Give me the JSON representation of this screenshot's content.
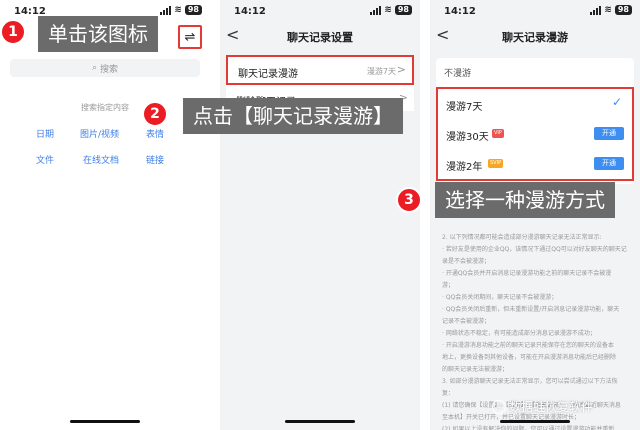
{
  "status_bar": {
    "time": "14:12",
    "battery": "98",
    "wifi": "≋"
  },
  "phone1": {
    "search_placeholder": "搜索",
    "search_icon": "⌕",
    "filter_icon": "⇌",
    "hint": "搜索指定内容",
    "categories": [
      "日期",
      "图片/视频",
      "表情",
      "文件",
      "在线文档",
      "链接"
    ]
  },
  "phone2": {
    "back": "<",
    "title": "聊天记录设置",
    "roam_label": "聊天记录漫游",
    "roam_value": "漫游7天",
    "roam_chevron": ">",
    "delete_label": "删除聊天记录",
    "delete_chevron": ">"
  },
  "phone3": {
    "back": "<",
    "title": "聊天记录漫游",
    "section": "不漫游",
    "plans": [
      {
        "name": "漫游7天",
        "check": "✓"
      },
      {
        "name": "漫游30天",
        "badge": "VIP",
        "button": "开通"
      },
      {
        "name": "漫游2年",
        "badge": "SVIP",
        "button": "开通"
      }
    ],
    "notes": [
      "2. 以下列情况都可能会造成部分漫游聊天记录无法正常显示:",
      "· 若好友是使用的企业QQ，该情况下通过QQ可以对好友聊天的聊天记",
      "录是不会被漫游；",
      "· 开通QQ会员并开启消息记录漫游功能之前的聊天记录不会被漫",
      "游；",
      "· QQ会员关闭期间，聊天记录不会被漫游；",
      "· QQ会员关闭后重新，但未重新设置/开启消息记录漫游功能，聊天",
      "记录不会被漫游；",
      "· 网络状态不稳定，有可能造成部分消息记录漫游不成功；",
      "· 开启漫游消息功能之前的聊天记录只能保存在您的聊天的设备本",
      "地上，更换设备到其他设备，可能在开启漫游消息功能后已经删除",
      "的聊天记录无法被漫游；",
      "3. 如部分漫游聊天记录无法正常显示，您可以尝试通过以下方法恢",
      "复：",
      "(1) 请您确保【设置】-【通用】-【聊天记录】-【同步最近聊天消息",
      "至本机】开关已打开，并已设置聊天记录漫游时长；",
      "(2) 如果以上没有解决你的问题，您可以通过设置漫游功能并重新",
      "备聊期的同步设备。"
    ]
  },
  "callouts": [
    {
      "number": "1",
      "text": "单击该图标"
    },
    {
      "number": "2",
      "text": "点击【聊天记录漫游】"
    },
    {
      "number": "3",
      "text": "选择一种漫游方式"
    }
  ],
  "watermark": {
    "text": "数据蛙恢复软件",
    "icon": "⊙"
  },
  "colors": {
    "highlight": "#e53935",
    "callout_bg": "#6b6b6b",
    "step_badge": "#ec1c24",
    "accent_blue": "#3d8ef0",
    "link_blue": "#3d7ee8"
  }
}
